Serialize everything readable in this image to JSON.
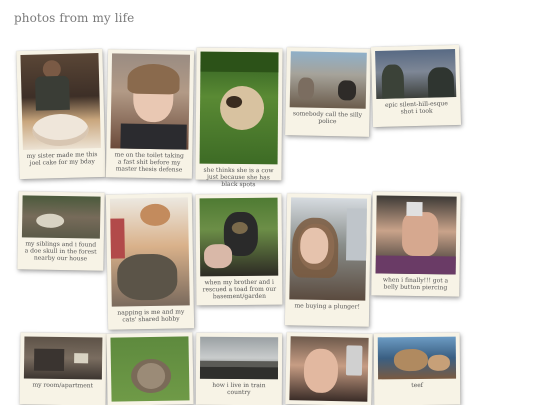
{
  "page": {
    "title": "photos from my life"
  },
  "photos": [
    {
      "caption": "my sister made me this joel cake for my bday",
      "scene": "person-with-cake"
    },
    {
      "caption": "me on the toilet taking a fast shit before my master thesis defense",
      "scene": "selfie-peace-sign"
    },
    {
      "caption": "she thinks she is a cow just because she has black spots",
      "scene": "cat-in-plants"
    },
    {
      "caption": "somebody call the silly police",
      "scene": "cats-on-patio"
    },
    {
      "caption": "epic silent-hill-esque shot i took",
      "scene": "foggy-trees"
    },
    {
      "caption": "my siblings and i found a doe skull in the forest nearby our house",
      "scene": "skull-on-ground"
    },
    {
      "caption": "napping is me and my cats' shared hobby",
      "scene": "napping-with-cat"
    },
    {
      "caption": "when my brother and i rescued a toad from our basement/garden",
      "scene": "toad-in-pot"
    },
    {
      "caption": "me buying a plunger!",
      "scene": "selfie-outdoors"
    },
    {
      "caption": "when i finally!!! got a belly button piercing",
      "scene": "mirror-selfie"
    },
    {
      "caption": "my room/apartment",
      "scene": "room"
    },
    {
      "caption": "",
      "scene": "hedgehog-on-grass"
    },
    {
      "caption": "how i live in train country",
      "scene": "train-tracks"
    },
    {
      "caption": "",
      "scene": "selfie-with-phone"
    },
    {
      "caption": "teef",
      "scene": "cat-teeth"
    }
  ]
}
